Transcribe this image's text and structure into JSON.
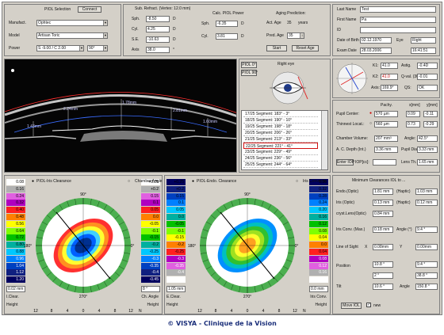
{
  "iol_panel": {
    "selection_label": "PIOL Selection",
    "connect_label": "Connect",
    "manufacturer_label": "Manufact.",
    "manufacturer_value": "Ophtec",
    "model_label": "Model",
    "model_value": "Artisan Toric",
    "power_label": "Power",
    "power_value": "S -9.00 / C 2.00",
    "axis_select": "90°"
  },
  "refraction": {
    "title": "Sub. Refract. (Vertex: 12.0 mm)",
    "sph_label": "Sph.",
    "sph_value": "-8.50",
    "sph_unit": "D",
    "cyl_label": "Cyl.",
    "cyl_value": "4.25",
    "cyl_unit": "D",
    "se_label": "S.E.",
    "se_value": "-10.63",
    "se_unit": "D",
    "axis_label": "Axis",
    "axis_value": "38.0",
    "axis_unit": "°"
  },
  "calc_power": {
    "title": "Calc. PIOL Power",
    "sph_label": "Sph.",
    "sph_value": "-6.35",
    "sph_unit": "D",
    "cyl_label": "Cyl.",
    "cyl_value": "3.81",
    "cyl_unit": "D"
  },
  "aging": {
    "title": "Aging Prediction:",
    "act_age_label": "Act. Age",
    "act_age_value": "35",
    "act_age_unit": "years",
    "pred_age_label": "Pred. Age",
    "pred_age_value": "35",
    "start_label": "Start",
    "reset_label": "Reset Age"
  },
  "patient": {
    "last_name_label": "Last Name",
    "last_name_value": "Test",
    "first_name_label": "First Name",
    "first_name_value": "Pa",
    "id_label": "ID",
    "id_value": "",
    "dob_label": "Date of Birth",
    "dob_value": "02.12.1970",
    "eye_label": "Eye",
    "eye_value": "Right",
    "exam_label": "Exam Date",
    "exam_date": "28.03.2006",
    "exam_time": "16:41:51"
  },
  "scan": {
    "piol0_label": "PIOL 0°",
    "piol90_label": "PIOL 90°",
    "eye_side": "Right eye",
    "measure_labels": [
      "1.43mm",
      "2.24mm",
      "1.78mm",
      "2.81mm",
      "1.60mm"
    ],
    "segments": [
      "17/25  Segment: 183° - 3°",
      "18/25  Segment: 190° - 10°",
      "19/25  Segment: 198° - 18°",
      "20/25  Segment: 206° - 26°",
      "21/25  Segment: 213° - 33°",
      "22/25  Segment: 221° - 41°",
      "23/25  Segment: 229° - 49°",
      "24/25  Segment: 236° - 56°",
      "25/25  Segment: 244° - 64°"
    ],
    "selected_segment": 5
  },
  "keratometry": {
    "k1_label": "K1:",
    "k1_value": "41.0",
    "k1_axis": "-0.4D",
    "astig_label": "Astig.",
    "k2_label": "K2:",
    "k2_value": "41.0",
    "k2_axis": "-0.01",
    "q_label": "Q-val. (30°)",
    "axis_label": "Axis:",
    "axis_value": "169.9°",
    "qs_label": "QS:",
    "qs_value": "OK"
  },
  "measurements": {
    "pachy_label": "Pachy.",
    "xmm_label": "x[mm]",
    "ymm_label": "y[mm]",
    "pupil_center_label": "Pupil Center:",
    "pupil_center_value": "570 µm",
    "pupil_x": "0.09",
    "pupil_y": "-0.11",
    "thinnest_label": "Thinnest Locat.:",
    "thinnest_value": "560 µm",
    "thinnest_x": "0.73",
    "thinnest_y": "-0.29",
    "chamber_vol_label": "Chamber Volume:",
    "chamber_vol_value": "207 mm³",
    "angle_label": "Angle:",
    "angle_value": "42.5°",
    "acd_label": "A. C. Depth (Int.)",
    "acd_value": "3.36 mm",
    "pupil_dia_label": "Pupil Dia.",
    "pupil_dia_value": "3.33 mm",
    "enter_iop_label": "Enter IOP",
    "iop_label": "IOP[cc]:",
    "lens_th_label": "Lens Th.:",
    "lens_th_value": "1.65 mm"
  },
  "iris_clearance": {
    "title": "PIOL-Iris Clearance",
    "alt_label": "Chamber Angle",
    "scale_left": [
      "0.08",
      "0.16",
      "0.24",
      "0.32",
      "0.40",
      "0.48",
      "0.56",
      "0.64",
      "0.72",
      "0.80",
      "0.88",
      "0.96",
      "1.04",
      "1.12",
      "1.20"
    ],
    "scale_right": [
      "+0.25",
      "+0.2",
      "0.15",
      "0.1",
      "0.05",
      "0.0",
      "-0.05",
      "-0.1",
      "-0.15",
      "-0.2",
      "-0.25",
      "-0.3",
      "-0.35",
      "-0.4",
      "-0.45"
    ],
    "left_footer": "0.02 mm",
    "left_footer_label": "I.Clear.",
    "left_footer_sub": "Height",
    "right_footer": "8 °",
    "right_footer_label": "Ch. Angle",
    "right_footer_sub": "Height",
    "angles": [
      "90°",
      "270°",
      "0°",
      "180°"
    ],
    "axis_ticks": [
      "12",
      "8",
      "4",
      "0",
      "4",
      "8",
      "12"
    ],
    "axis_end": "N"
  },
  "endo_clearance": {
    "title": "PIOL-Endo. Clearance",
    "alt_label": "Iris Convexity",
    "scale_left": [
      "+0.25",
      "+0.2",
      "0.15",
      "0.1",
      "0.05",
      "0.0",
      "-0.05",
      "-0.1",
      "-0.15",
      "-0.2",
      "-0.25",
      "-0.3",
      "-0.35",
      "-0.4",
      "-0.45"
    ],
    "scale_right": [
      "0.36",
      "0.32",
      "0.28",
      "0.24",
      "0.20",
      "0.16",
      "0.12",
      "0.08",
      "0.04",
      "0.0",
      "0.04",
      "0.08",
      "0.12",
      "0.16",
      "0.20"
    ],
    "left_footer": "1.05 mm",
    "left_footer_label": "E.Clear.",
    "left_footer_sub": "Height",
    "right_footer": "0.0 mm",
    "right_footer_label": "Iris Conv.",
    "right_footer_sub": "Height",
    "angles": [
      "90°",
      "270°",
      "0°",
      "180°"
    ],
    "axis_ticks": [
      "12",
      "8",
      "4",
      "0",
      "4",
      "8",
      "12"
    ],
    "axis_end": "N"
  },
  "min_clearances": {
    "title": "Minimum Clearances IOL to ...",
    "endo_label": "Endo.(Optic)",
    "endo_value": "1.81 mm",
    "endo_haptic_label": "(Haptic)",
    "endo_haptic": "1.03 mm",
    "iris_label": "Iris (Optic)",
    "iris_value": "0.13 mm",
    "iris_haptic_label": "(Haptic)",
    "iris_haptic": "0.12 mm",
    "crystal_label": "cryst.Lens(Optic)",
    "crystal_value": "0.84 mm",
    "conv_label": "Iris Conv. (Max.)",
    "conv_value": "0.18 mm",
    "conv_angle_label": "Angle (°)",
    "conv_angle": "9.4 °",
    "los_label": "Line of Sight",
    "los_x_label": "X",
    "los_x": "0.08mm",
    "los_y_label": "Y",
    "los_y": "0.00mm",
    "position_label": "Position",
    "pos_x": "10.8 °",
    "pos_x2": "9.4 °",
    "pos_y": "2 °",
    "pos_y2": "38.8 °",
    "tilt_label": "Tilt",
    "tilt_value": "10.6 °",
    "angle_label": "Angle",
    "tilt_angle": "150.8 °",
    "move_iol_label": "Move IOL",
    "new_label": "new"
  },
  "caption": "© VISYA - Clinique de la Vision"
}
